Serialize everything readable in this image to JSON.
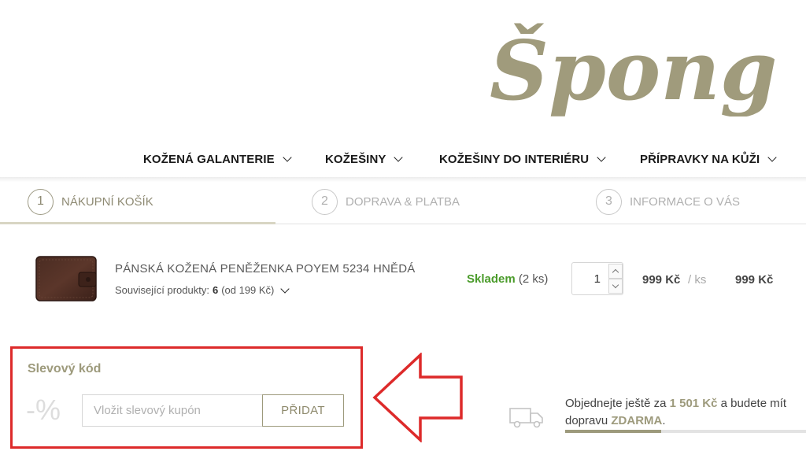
{
  "logo": {
    "text": "Špongr",
    "color": "#a09b7c"
  },
  "nav": {
    "items": [
      {
        "label": "KOŽENÁ GALANTERIE"
      },
      {
        "label": "KOŽEŠINY"
      },
      {
        "label": "KOŽEŠINY DO INTERIÉRU"
      },
      {
        "label": "PŘÍPRAVKY NA KŮŽI"
      }
    ]
  },
  "steps": [
    {
      "number": "1",
      "label": "NÁKUPNÍ KOŠÍK",
      "active": true
    },
    {
      "number": "2",
      "label": "DOPRAVA & PLATBA",
      "active": false
    },
    {
      "number": "3",
      "label": "INFORMACE O VÁS",
      "active": false
    }
  ],
  "cart_item": {
    "image_icon": "wallet-product-image",
    "name": "PÁNSKÁ KOŽENÁ PENĚŽENKA POYEM 5234 HNĚDÁ",
    "related_label": "Související produkty:",
    "related_count": "6",
    "related_from": "(od 199 Kč)",
    "stock_status": "Skladem",
    "stock_qty": "(2 ks)",
    "quantity": "1",
    "unit_price": "999 Kč",
    "per_unit": "/ ks",
    "total_price": "999 Kč"
  },
  "coupon": {
    "title": "Slevový kód",
    "percent_icon": "-%",
    "placeholder": "Vložit slevový kupón",
    "button_label": "PŘIDAT"
  },
  "shipping": {
    "prefix": "Objednejte ještě za",
    "amount": "1 501 Kč",
    "middle": "a budete mít dopravu",
    "free": "ZDARMA",
    "suffix": ".",
    "progress_fraction": 0.4
  },
  "colors": {
    "accent": "#9d9a7c",
    "stock_ok": "#4a9b2a",
    "highlight_red": "#dd2a2a"
  }
}
